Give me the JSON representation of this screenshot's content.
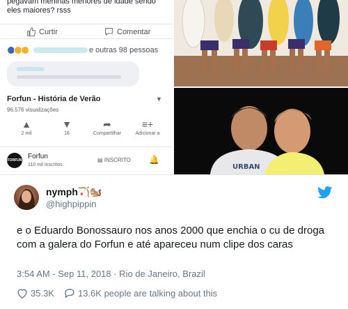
{
  "facebook": {
    "comment_text": "pegavam meninas menores de idade sendo eles maiores? rsss",
    "like_label": "Curtir",
    "comment_label": "Comentar",
    "reactions_text": "e outras 98 pessoas"
  },
  "youtube": {
    "video_title": "Forfun - História de Verão",
    "views": "96.576 visualizações",
    "actions": [
      {
        "label": "2 mil"
      },
      {
        "label": "16"
      },
      {
        "label": "Compartilhar"
      },
      {
        "label": "Adicionar a"
      }
    ],
    "channel_name": "Forfun",
    "channel_subs": "110 mil inscritos",
    "subscribed_label": "INSCRITO",
    "avatar_text": "FORFUN"
  },
  "tweet": {
    "display_name": "nymph🏹🐿️",
    "handle": "@highpippin",
    "text": "e o Eduardo Bonossauro nos anos 2000 que enchia o cu de droga com a galera do Forfun e até apareceu num clipe dos caras",
    "timestamp": "3:54 AM - Sep 11, 2018 · Rio de Janeiro, Brazil",
    "likes": "35.3K",
    "talking": "13.6K people are talking about this",
    "accent_color": "#1da1f2"
  }
}
